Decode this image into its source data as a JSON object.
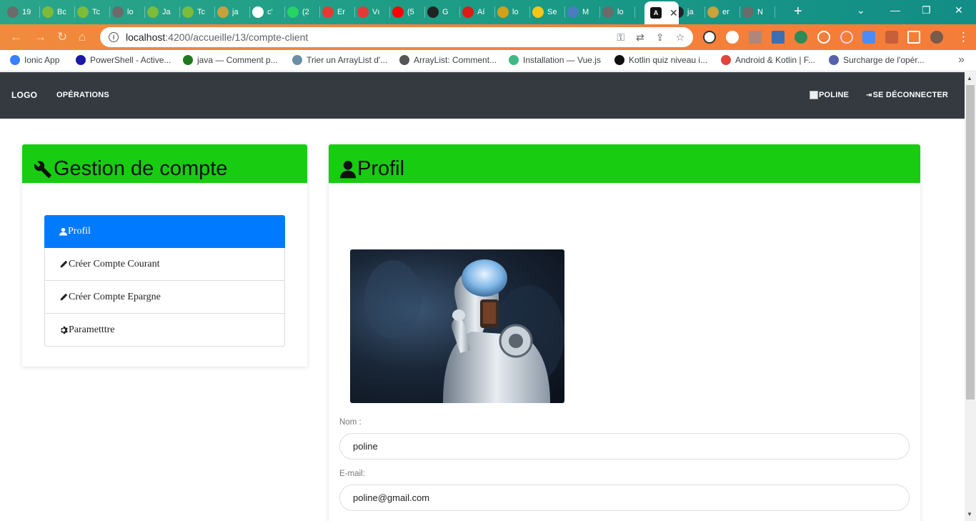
{
  "browser": {
    "tabs": [
      {
        "label": "19",
        "color": "#6b6b6b"
      },
      {
        "label": "Bc",
        "color": "#7dbb3a"
      },
      {
        "label": "Tc",
        "color": "#7dbb3a"
      },
      {
        "label": "lo",
        "color": "#6b6b6b"
      },
      {
        "label": "Ja",
        "color": "#7dbb3a"
      },
      {
        "label": "Tc",
        "color": "#7dbb3a"
      },
      {
        "label": "ja",
        "color": "#c8a23c"
      },
      {
        "label": "c'",
        "color": "#ffffff"
      },
      {
        "label": "(2",
        "color": "#25d366"
      },
      {
        "label": "Er",
        "color": "#e53935"
      },
      {
        "label": "Vı",
        "color": "#e53935"
      },
      {
        "label": "(5",
        "color": "#ff0000"
      },
      {
        "label": "G",
        "color": "#222222"
      },
      {
        "label": "Aí",
        "color": "#dd1b16"
      },
      {
        "label": "lo",
        "color": "#d4a017"
      },
      {
        "label": "Se",
        "color": "#f5c518"
      },
      {
        "label": "M",
        "color": "#4a7dbf"
      },
      {
        "label": "lo",
        "color": "#6b6b6b"
      },
      {
        "label": "ja",
        "color": "#222222"
      },
      {
        "label": "er",
        "color": "#c8a23c"
      },
      {
        "label": "N",
        "color": "#6b6b6b"
      }
    ],
    "active_tab_glyph": "A",
    "new_tab": "+",
    "url_host": "localhost",
    "url_path": ":4200/accueille/13/compte-client",
    "window_controls": [
      "⌄",
      "—",
      "❐",
      "✕"
    ],
    "bookmarks": [
      {
        "label": "Ionic App",
        "color": "#3880ff"
      },
      {
        "label": "PowerShell - Active...",
        "color": "#1a1aa6"
      },
      {
        "label": "java — Comment p...",
        "color": "#1f7a1f"
      },
      {
        "label": "Trier un ArrayList d'...",
        "color": "#6b8ea6"
      },
      {
        "label": "ArrayList: Comment...",
        "color": "#555555"
      },
      {
        "label": "Installation — Vue.js",
        "color": "#41b883"
      },
      {
        "label": "Kotlin quiz niveau i...",
        "color": "#111111"
      },
      {
        "label": "Android & Kotlin | F...",
        "color": "#e0443a"
      },
      {
        "label": "Surcharge de l'opér...",
        "color": "#5561a8"
      }
    ],
    "bookmarks_more": "»"
  },
  "nav": {
    "logo": "LOGO",
    "operations": "OPÉRATIONS",
    "user": "POLINE",
    "logout": "SE DÉCONNECTER"
  },
  "left_card": {
    "title": "Gestion de compte",
    "menu": [
      {
        "label": "Profil",
        "icon": "user-icon",
        "active": true
      },
      {
        "label": "Créer Compte Courant",
        "icon": "pencil-icon",
        "active": false
      },
      {
        "label": "Créer Compte Epargne",
        "icon": "pencil-icon",
        "active": false
      },
      {
        "label": "Parametttre",
        "icon": "gear-icon",
        "active": false
      }
    ]
  },
  "profile_card": {
    "title": "Profil",
    "photo_alt": "robot-image",
    "name_label": "Nom :",
    "name_value": "poline",
    "email_label": "E-mail:",
    "email_value": "poline@gmail.com"
  },
  "colors": {
    "header_green": "#18cc12",
    "nav_dark": "#343a40",
    "active_blue": "#007bff"
  }
}
